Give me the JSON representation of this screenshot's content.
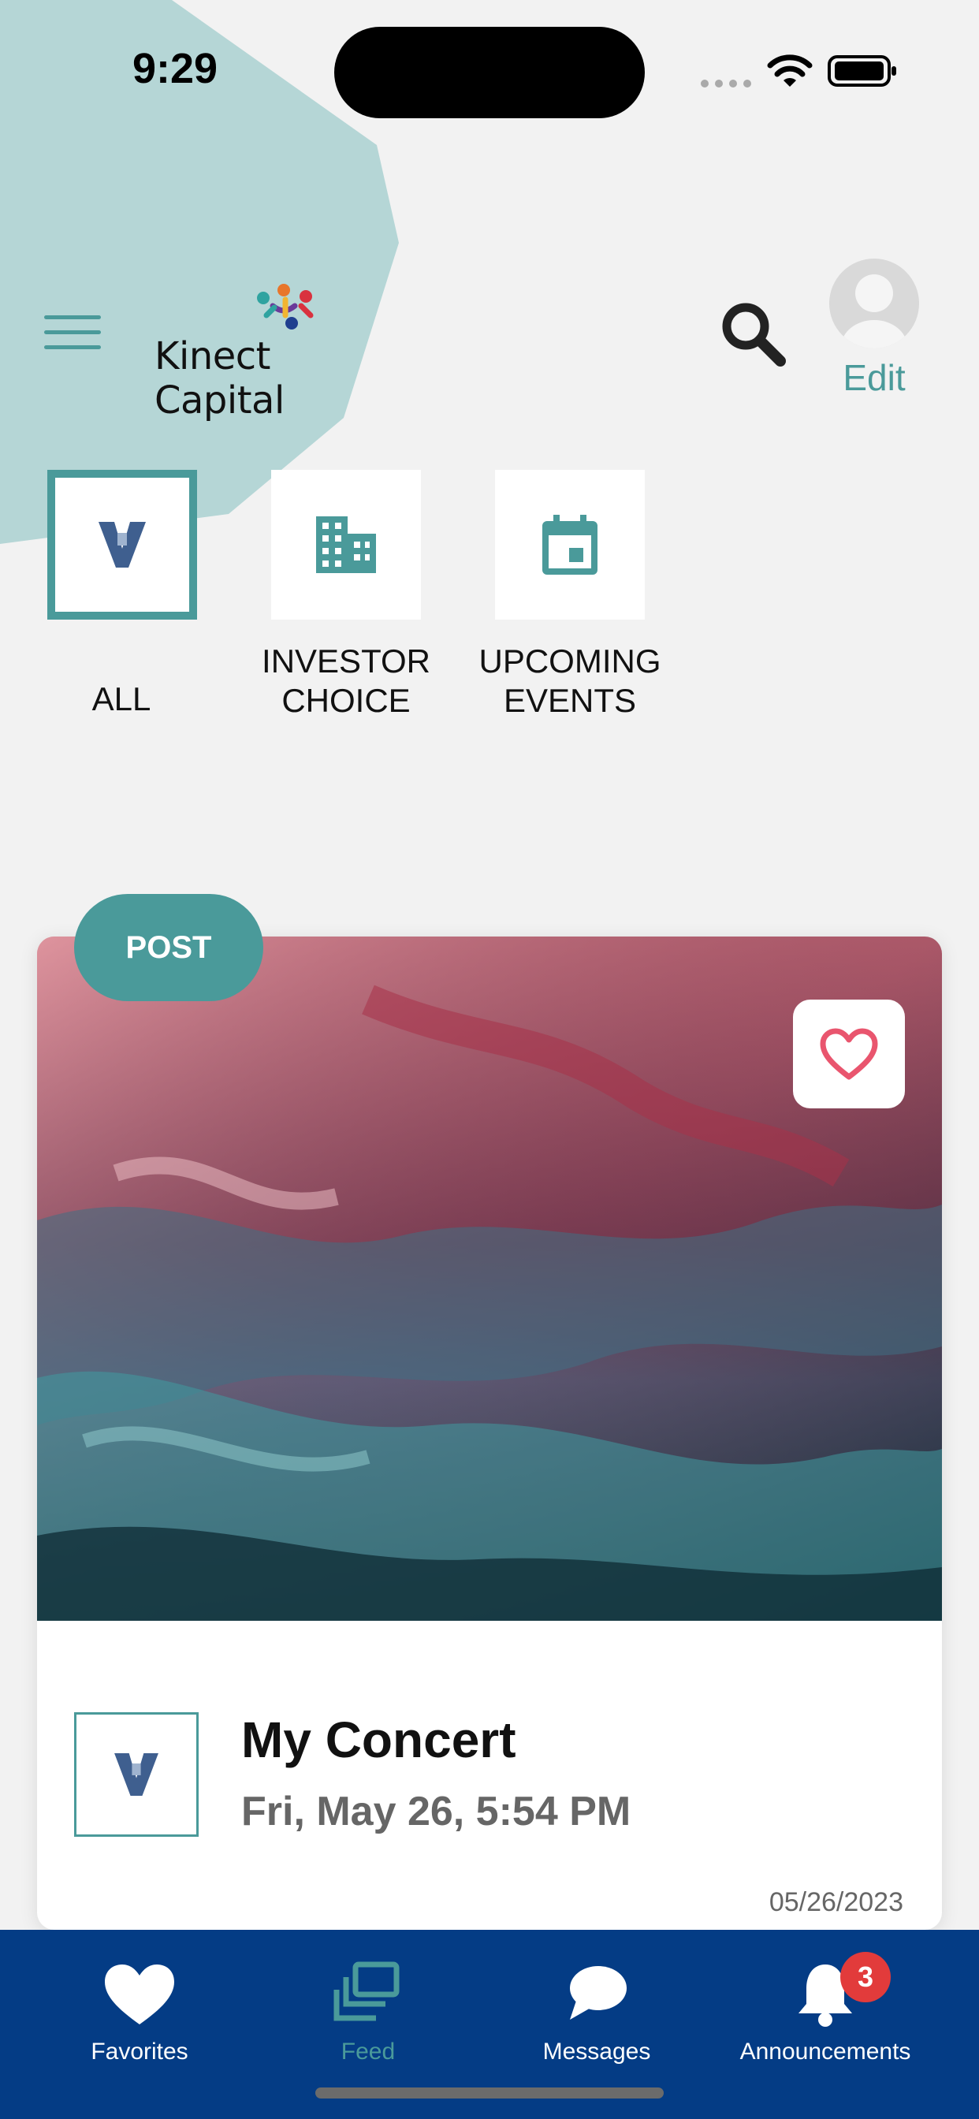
{
  "status_bar": {
    "time": "9:29"
  },
  "header": {
    "brand": "Kinect Capital",
    "edit_label": "Edit"
  },
  "categories": [
    {
      "label": "ALL",
      "icon": "v-logo-icon",
      "selected": true
    },
    {
      "label": "INVESTOR\nCHOICE",
      "icon": "building-icon",
      "selected": false
    },
    {
      "label": "UPCOMING\nEVENTS",
      "icon": "calendar-icon",
      "selected": false
    }
  ],
  "card": {
    "badge": "POST",
    "title": "My Concert",
    "date": "Fri, May 26, 5:54 PM",
    "stamp": "05/26/2023"
  },
  "tabbar": {
    "items": [
      {
        "label": "Favorites",
        "icon": "heart-icon"
      },
      {
        "label": "Feed",
        "icon": "feed-icon"
      },
      {
        "label": "Messages",
        "icon": "chat-bubble-icon"
      },
      {
        "label": "Announcements",
        "icon": "bell-icon"
      }
    ],
    "announcements_badge": "3"
  },
  "colors": {
    "accent": "#4a9a9a",
    "tabbar": "#043c85",
    "badge": "#e23b3b"
  }
}
